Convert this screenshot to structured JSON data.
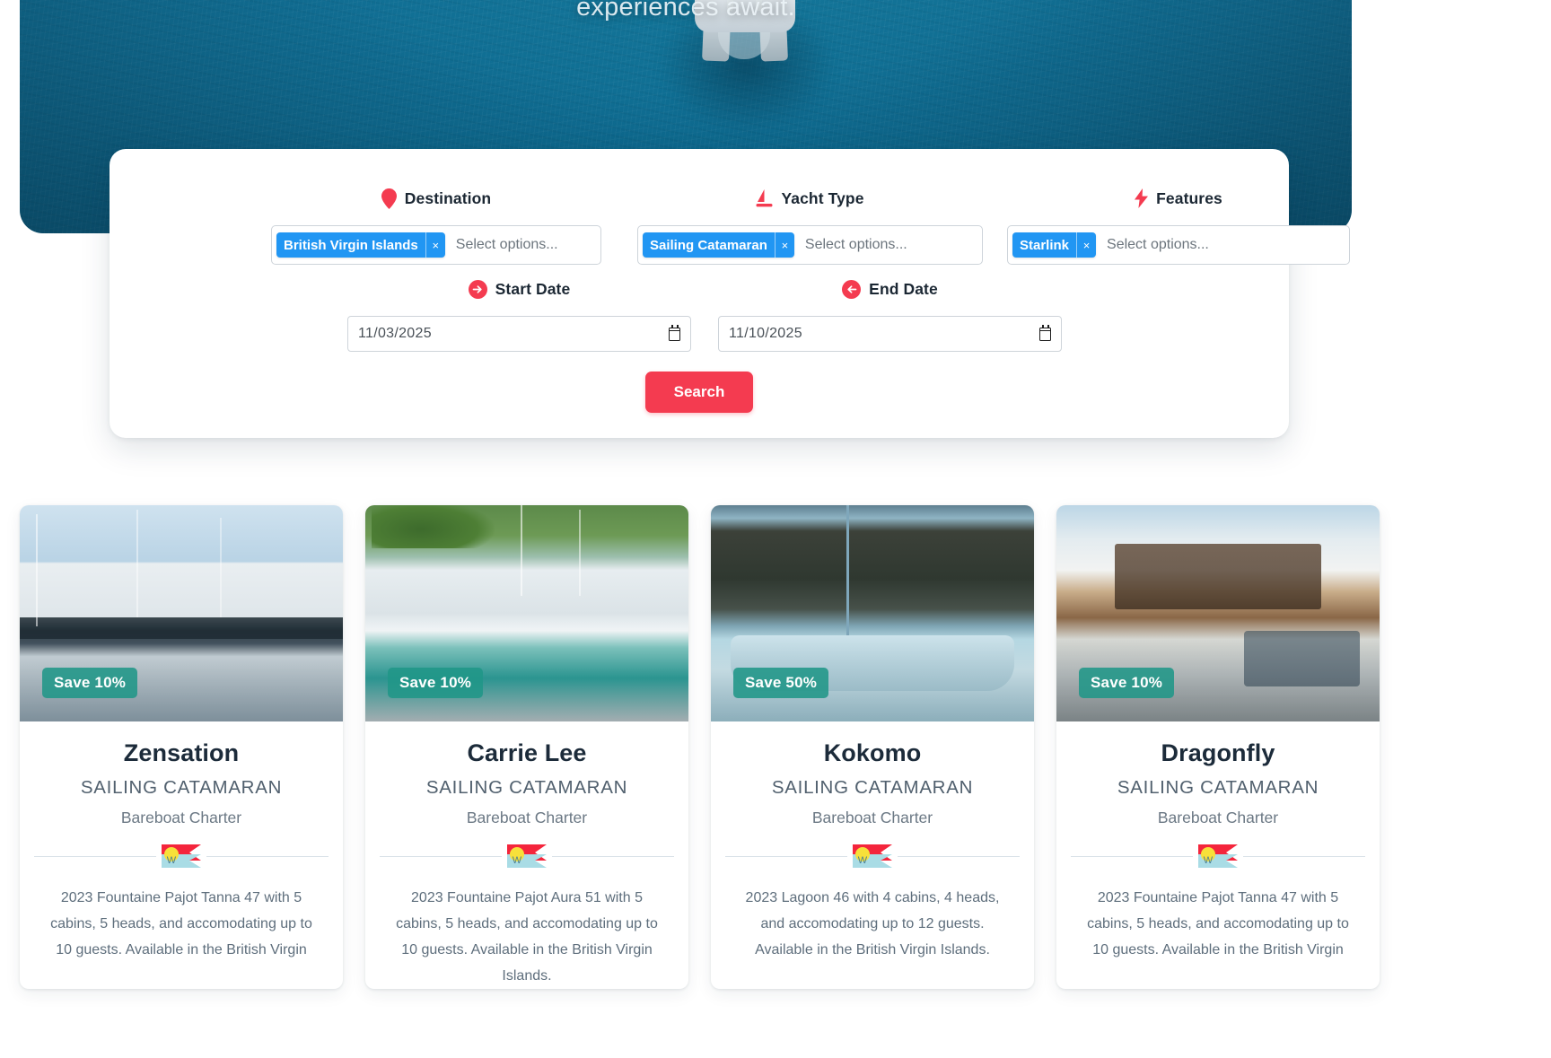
{
  "hero": {
    "tagline": "experiences await.",
    "ocean_color": "#116d92",
    "boat_alt": "catamaran-aerial"
  },
  "search": {
    "fields": [
      {
        "label": "Destination",
        "icon": "map-pin-icon",
        "icon_color": "#f43b50",
        "chip": "British Virgin Islands",
        "chip_remove": "×",
        "placeholder": "Select options..."
      },
      {
        "label": "Yacht Type",
        "icon": "sailboat-icon",
        "icon_color": "#f43b50",
        "chip": "Sailing Catamaran",
        "chip_remove": "×",
        "placeholder": "Select options..."
      },
      {
        "label": "Features",
        "icon": "lightning-bolt-icon",
        "icon_color": "#f43b50",
        "chip": "Starlink",
        "chip_remove": "×",
        "placeholder": "Select options..."
      }
    ],
    "dates": [
      {
        "label": "Start Date",
        "icon": "arrow-right-circle-icon",
        "value": "11/03/2025"
      },
      {
        "label": "End Date",
        "icon": "arrow-left-circle-icon",
        "value": "11/10/2025"
      }
    ],
    "submit_label": "Search",
    "accent_color": "#f43b50",
    "chip_color": "#2196f3"
  },
  "results": {
    "badge_color": "#209687",
    "cards": [
      {
        "badge": "Save 10%",
        "title": "Zensation",
        "type": "SAILING CATAMARAN",
        "charter": "Bareboat Charter",
        "description": "2023 Fountaine Pajot Tanna 47 with 5 cabins, 5 heads, and accomodating up to 10 guests. Available in the British Virgin",
        "photo": "zensation-catamaran-dock-photo"
      },
      {
        "badge": "Save 10%",
        "title": "Carrie Lee",
        "type": "SAILING CATAMARAN",
        "charter": "Bareboat Charter",
        "description": "2023 Fountaine Pajot Aura 51 with 5 cabins, 5 heads, and accomodating up to 10 guests. Available in the British Virgin Islands.",
        "photo": "carrie-lee-catamaran-marina-photo"
      },
      {
        "badge": "Save 50%",
        "title": "Kokomo",
        "type": "SAILING CATAMARAN",
        "charter": "Bareboat Charter",
        "description": "2023 Lagoon 46 with 4 cabins, 4 heads, and accomodating up to 12 guests. Available in the British Virgin Islands.",
        "photo": "kokomo-catamaran-anchored-photo"
      },
      {
        "badge": "Save 10%",
        "title": "Dragonfly",
        "type": "SAILING CATAMARAN",
        "charter": "Bareboat Charter",
        "description": "2023 Fountaine Pajot Tanna 47 with 5 cabins, 5 heads, and accomodating up to 10 guests. Available in the British Virgin",
        "photo": "dragonfly-catamaran-interior-photo"
      }
    ]
  }
}
